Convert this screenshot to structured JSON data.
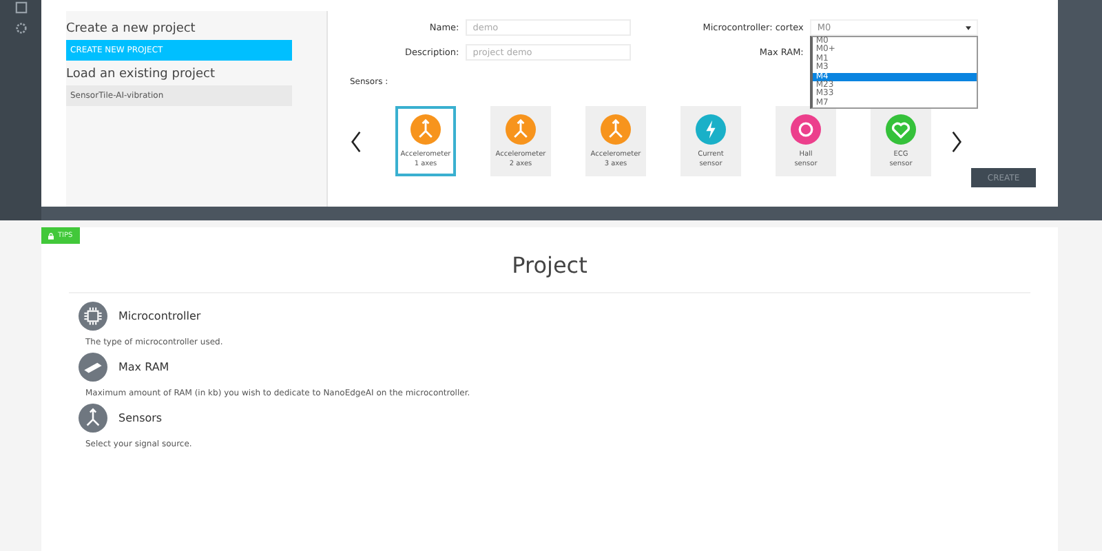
{
  "left_panel": {
    "create_heading": "Create a new project",
    "create_button": "CREATE NEW PROJECT",
    "load_heading": "Load an existing project",
    "existing_projects": [
      {
        "name": "SensorTile-AI-vibration",
        "selected": false
      }
    ]
  },
  "form": {
    "name_label": "Name:",
    "name_value": "demo",
    "description_label": "Description:",
    "description_value": "project demo",
    "microcontroller_label": "Microcontroller: cortex",
    "microcontroller_value": "M0",
    "max_ram_label": "Max RAM:",
    "dropdown_options": [
      {
        "label": "M0",
        "selected": false
      },
      {
        "label": "M0+",
        "selected": false
      },
      {
        "label": "M1",
        "selected": false
      },
      {
        "label": "M3",
        "selected": false
      },
      {
        "label": "M4",
        "selected": true
      },
      {
        "label": "M23",
        "selected": false
      },
      {
        "label": "M33",
        "selected": false
      },
      {
        "label": "M7",
        "selected": false
      }
    ]
  },
  "sensors_label": "Sensors :",
  "sensors": [
    {
      "kind": "accelerometer",
      "line1": "Accelerometer",
      "line2": "1 axes",
      "color": "#f7941d",
      "selected": true
    },
    {
      "kind": "accelerometer",
      "line1": "Accelerometer",
      "line2": "2 axes",
      "color": "#f7941d",
      "selected": false
    },
    {
      "kind": "accelerometer",
      "line1": "Accelerometer",
      "line2": "3 axes",
      "color": "#f7941d",
      "selected": false
    },
    {
      "kind": "current",
      "line1": "Current",
      "line2": "sensor",
      "color": "#1ab0c8",
      "selected": false
    },
    {
      "kind": "hall",
      "line1": "Hall",
      "line2": "sensor",
      "color": "#ec3f8c",
      "selected": false
    },
    {
      "kind": "ecg",
      "line1": "ECG",
      "line2": "sensor",
      "color": "#35c13a",
      "selected": false
    }
  ],
  "create_button": "CREATE",
  "tips": {
    "badge": "TIPS",
    "title": "Project",
    "items": [
      {
        "kind": "chip",
        "title": "Microcontroller",
        "text": "The type of microcontroller used."
      },
      {
        "kind": "ram",
        "title": "Max RAM",
        "text": "Maximum amount of RAM (in kb) you wish to dedicate to NanoEdgeAI on the microcontroller."
      },
      {
        "kind": "sensors",
        "title": "Sensors",
        "text": "Select your signal source."
      }
    ]
  }
}
